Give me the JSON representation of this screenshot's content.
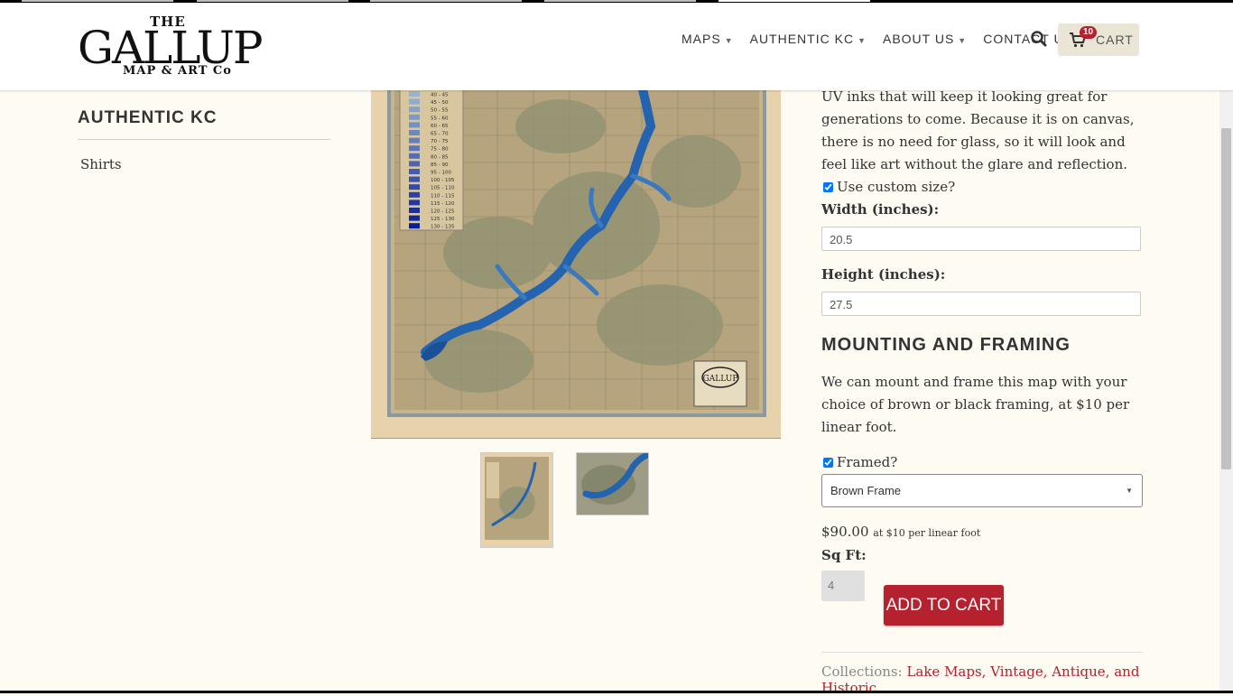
{
  "header": {
    "logo": {
      "the": "THE",
      "name": "GALLUP",
      "sub": "MAP & ART Co"
    },
    "nav": [
      {
        "label": "MAPS",
        "dropdown": true
      },
      {
        "label": "AUTHENTIC KC",
        "dropdown": true
      },
      {
        "label": "ABOUT US",
        "dropdown": true
      },
      {
        "label": "CONTACT US",
        "dropdown": false
      }
    ],
    "cart": {
      "label": "CART",
      "count": "10"
    }
  },
  "sidebar": {
    "title": "AUTHENTIC KC",
    "items": [
      "Shirts"
    ]
  },
  "map": {
    "legend": [
      "40 - 45",
      "45 - 50",
      "50 - 55",
      "55 - 60",
      "60 - 65",
      "65 - 70",
      "70 - 75",
      "75 - 80",
      "80 - 85",
      "85 - 90",
      "95 - 100",
      "100 - 105",
      "105 - 110",
      "110 - 115",
      "115 - 120",
      "120 - 125",
      "125 - 130",
      "130 - 135"
    ],
    "thumb_logo": "GALLUP"
  },
  "product": {
    "description": "UV inks that will keep it looking great for generations to come. Because it is on canvas, there is no need for glass, so it will look and feel like art without the glare and reflection.",
    "custom_size_label": "Use custom size?",
    "custom_size_checked": true,
    "width_label": "Width (inches):",
    "width_value": "20.5",
    "height_label": "Height (inches):",
    "height_value": "27.5",
    "mounting_heading": "MOUNTING AND FRAMING",
    "mounting_text": "We can mount and frame this map with your choice of brown or black framing, at $10 per linear foot.",
    "framed_label": "Framed?",
    "framed_checked": true,
    "frame_selected": "Brown Frame",
    "price": "$90.00",
    "price_note": "at $10 per linear foot",
    "sqft_label": "Sq Ft:",
    "sqft_value": "4",
    "add_to_cart": "ADD TO CART",
    "collections_label": "Collections:",
    "collections": "Lake Maps, Vintage, Antique, and Historic"
  },
  "colors": {
    "accent": "#b5212f",
    "background": "#fdfbf2",
    "cart_bg": "#ebe5d6",
    "map_paper": "#e8d2ab",
    "lake_blue": "#2463b0"
  }
}
